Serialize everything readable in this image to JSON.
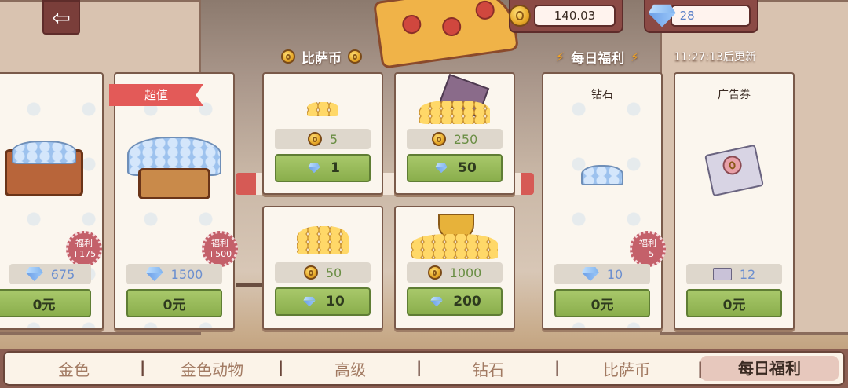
{
  "header": {
    "back_icon": "back-arrow-icon",
    "coins": "140.03",
    "gems": "28"
  },
  "sections": {
    "pizza_coins": "比萨币",
    "daily": "每日福利",
    "refresh_time": "11:27:13后更新"
  },
  "cards": {
    "c1": {
      "price": "675",
      "bonus_label": "福利",
      "bonus_value": "+175",
      "buy": "0元"
    },
    "c2": {
      "ribbon": "超值",
      "price": "1500",
      "bonus_label": "福利",
      "bonus_value": "+500",
      "buy": "0元"
    },
    "p1": {
      "amount": "5",
      "cost": "1"
    },
    "p2": {
      "amount": "250",
      "cost": "50"
    },
    "p3": {
      "amount": "50",
      "cost": "10"
    },
    "p4": {
      "amount": "1000",
      "cost": "200"
    },
    "d1": {
      "title": "钻石",
      "price": "10",
      "bonus_label": "福利",
      "bonus_value": "+5",
      "buy": "0元"
    },
    "d2": {
      "title": "广告券",
      "price": "12",
      "buy": "0元"
    }
  },
  "tabs": [
    "金色",
    "金色动物",
    "高级",
    "钻石",
    "比萨币",
    "每日福利"
  ],
  "colors": {
    "buy_green": "#9dbd5c",
    "bonus_pink": "#c4606a",
    "ribbon_red": "#e35a58"
  }
}
